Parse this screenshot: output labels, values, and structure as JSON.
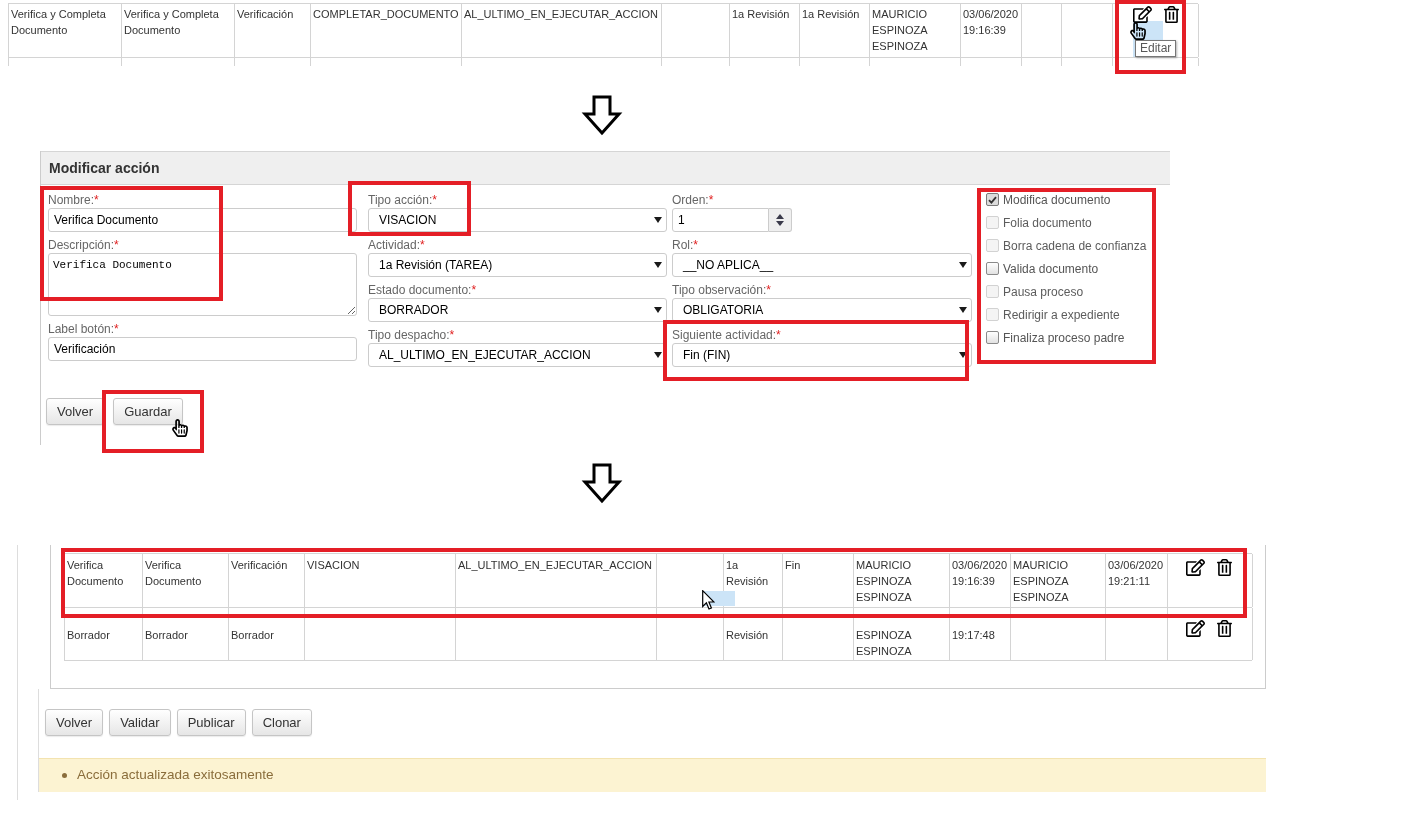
{
  "list_before": {
    "rows": [
      {
        "cells": {
          "column_1": "Verifica y Completa Documento",
          "column_2": "Verifica y Completa Documento",
          "column_3": "Verificación",
          "column_4": "COMPLETAR_DOCUMENTO",
          "column_5": "AL_ULTIMO_EN_EJECUTAR_ACCION",
          "column_7": "1a Revisión",
          "column_8": "1a Revisión",
          "column_9": "MAURICIO ESPINOZA ESPINOZA",
          "column_10": "03/06/2020 19:16:39"
        },
        "edit_hovered": true,
        "edit_tooltip": "Editar"
      }
    ]
  },
  "form": {
    "title": "Modificar acción",
    "field_columns": [
      {
        "fields": [
          {
            "kind": "text",
            "label": "Nombre:",
            "required_mark": "*",
            "value": "Verifica Documento"
          },
          {
            "kind": "textarea",
            "label": "Descripción:",
            "required_mark": "*",
            "value": "Verifica Documento"
          },
          {
            "kind": "text",
            "label": "Label botón:",
            "required_mark": "*",
            "value": "Verificación"
          }
        ]
      },
      {
        "fields": [
          {
            "kind": "select",
            "label": "Tipo acción:",
            "required_mark": "*",
            "value": "VISACION"
          },
          {
            "kind": "select",
            "label": "Actividad:",
            "required_mark": "*",
            "value": "1a Revisión (TAREA)"
          },
          {
            "kind": "select",
            "label": "Estado documento:",
            "required_mark": "*",
            "value": "BORRADOR"
          },
          {
            "kind": "select",
            "label": "Tipo despacho:",
            "required_mark": "*",
            "value": "AL_ULTIMO_EN_EJECUTAR_ACCION"
          }
        ]
      },
      {
        "fields": [
          {
            "kind": "number",
            "label": "Orden:",
            "required_mark": "*",
            "value": "1"
          },
          {
            "kind": "select",
            "label": "Rol:",
            "required_mark": "*",
            "value": "__NO APLICA__"
          },
          {
            "kind": "select",
            "label": "Tipo observación:",
            "required_mark": "*",
            "value": "OBLIGATORIA"
          },
          {
            "kind": "select",
            "label": "Siguiente actividad:",
            "required_mark": "*",
            "value": "Fin (FIN)"
          }
        ]
      }
    ],
    "checkboxes": [
      {
        "label": "Modifica documento",
        "checked": true,
        "disabled": false
      },
      {
        "label": "Folia documento",
        "checked": false,
        "disabled": true
      },
      {
        "label": "Borra cadena de confianza",
        "checked": false,
        "disabled": true
      },
      {
        "label": "Valida documento",
        "checked": false,
        "disabled": false
      },
      {
        "label": "Pausa proceso",
        "checked": false,
        "disabled": true
      },
      {
        "label": "Redirigir a expediente",
        "checked": false,
        "disabled": true
      },
      {
        "label": "Finaliza proceso padre",
        "checked": false,
        "disabled": false
      }
    ],
    "buttons": [
      {
        "label": "Volver",
        "hovered": false
      },
      {
        "label": "Guardar",
        "hovered": true
      }
    ]
  },
  "list_after": {
    "rows": [
      {
        "cells": {
          "column_1": "Verifica Documento",
          "column_2": "Verifica Documento",
          "column_3": "Verificación",
          "column_4": "VISACION",
          "column_5": "AL_ULTIMO_EN_EJECUTAR_ACCION",
          "column_7": "1a Revisión",
          "column_8": "Fin",
          "column_9": "MAURICIO ESPINOZA ESPINOZA",
          "column_10": "03/06/2020 19:16:39",
          "column_11": "MAURICIO ESPINOZA ESPINOZA",
          "column_12": "03/06/2020 19:21:11"
        }
      },
      {
        "cells": {
          "column_1": "Borrador",
          "column_2": "Borrador",
          "column_3": "Borrador",
          "column_7": "Revisión",
          "column_9": "ESPINOZA ESPINOZA",
          "column_10": "19:17:48"
        }
      }
    ]
  },
  "buttons": [
    "Volver",
    "Validar",
    "Publicar",
    "Clonar"
  ],
  "message": {
    "text": "Acción actualizada exitosamente"
  }
}
